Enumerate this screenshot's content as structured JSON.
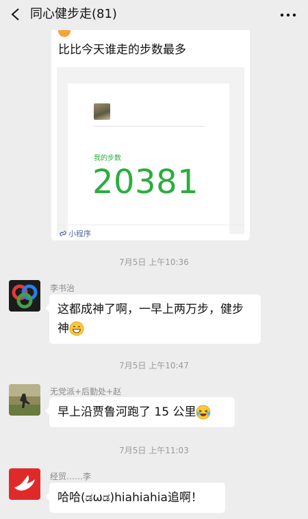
{
  "header": {
    "title": "同心健步走(81)"
  },
  "mini_program": {
    "title": "比比今天谁走的步数最多",
    "steps_label": "我的步数",
    "steps_value": "20381",
    "footer_label": "小程序"
  },
  "messages": [
    {
      "timestamp": "7月5日 上午10:36",
      "sender": "李书治",
      "text": "这都成神了啊，一早上两万步，健步神"
    },
    {
      "timestamp": "7月5日 上午10:47",
      "sender": "无党派+后勤处+赵",
      "text": "早上沿贾鲁河跑了 15 公里"
    },
    {
      "timestamp": "7月5日 上午11:03",
      "sender": "经贸……李",
      "text": "哈哈(ಡωಡ)hiahiahia追啊！"
    }
  ],
  "colors": {
    "background": "#ededed",
    "steps_green": "#2aad3d",
    "link_blue": "#576b95"
  },
  "icons": [
    "back-icon",
    "more-icon",
    "mini-program-link-icon",
    "smile-emoji-icon",
    "laugh-cry-emoji-icon"
  ]
}
